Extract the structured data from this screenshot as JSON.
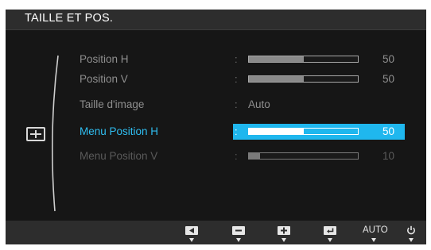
{
  "title": "TAILLE ET POS.",
  "menu_icon": "picture-size-icon",
  "items": [
    {
      "label": "Position H",
      "type": "slider",
      "value": 50,
      "max": 100,
      "selected": false,
      "dim": false
    },
    {
      "label": "Position V",
      "type": "slider",
      "value": 50,
      "max": 100,
      "selected": false,
      "dim": false
    },
    {
      "label": "Taille d'image",
      "type": "option",
      "value": "Auto",
      "selected": false,
      "dim": false
    },
    {
      "label": "Menu Position H",
      "type": "slider",
      "value": 50,
      "max": 100,
      "selected": true,
      "dim": false
    },
    {
      "label": "Menu Position V",
      "type": "slider",
      "value": 10,
      "max": 100,
      "selected": false,
      "dim": true
    }
  ],
  "colon": ":",
  "buttons": [
    {
      "name": "left-arrow-button",
      "icon": "triangle-left-icon"
    },
    {
      "name": "minus-button",
      "icon": "minus-icon"
    },
    {
      "name": "plus-button",
      "icon": "plus-icon"
    },
    {
      "name": "enter-button",
      "icon": "enter-icon"
    },
    {
      "name": "auto-button",
      "label": "AUTO"
    },
    {
      "name": "power-button",
      "icon": "power-icon"
    }
  ],
  "colors": {
    "accent": "#1fb7ee",
    "selected_label": "#2fbdf0",
    "panel_bg": "#161616",
    "bar_bg": "#2d2d2d"
  }
}
